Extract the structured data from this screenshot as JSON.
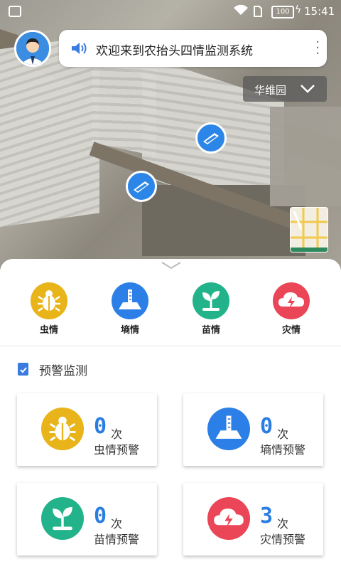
{
  "status_bar": {
    "battery": "100",
    "time": "15:41"
  },
  "header": {
    "banner_text": "欢迎来到农抬头四情监测系统",
    "location": "华维园"
  },
  "categories": [
    {
      "label": "虫情",
      "icon": "bug-icon",
      "color": "#e8b419"
    },
    {
      "label": "墒情",
      "icon": "soil-gauge-icon",
      "color": "#2c7fe6"
    },
    {
      "label": "苗情",
      "icon": "sprout-icon",
      "color": "#22b38a"
    },
    {
      "label": "灾情",
      "icon": "cloud-lightning-icon",
      "color": "#ea4657"
    }
  ],
  "warning_section": {
    "title": "预警监测",
    "cards": [
      {
        "count": "0",
        "unit": "次",
        "name": "虫情预警",
        "color": "#e8b419"
      },
      {
        "count": "0",
        "unit": "次",
        "name": "墒情预警",
        "color": "#2c7fe6"
      },
      {
        "count": "0",
        "unit": "次",
        "name": "苗情预警",
        "color": "#22b38a"
      },
      {
        "count": "3",
        "unit": "次",
        "name": "灾情预警",
        "color": "#ea4657"
      }
    ]
  }
}
